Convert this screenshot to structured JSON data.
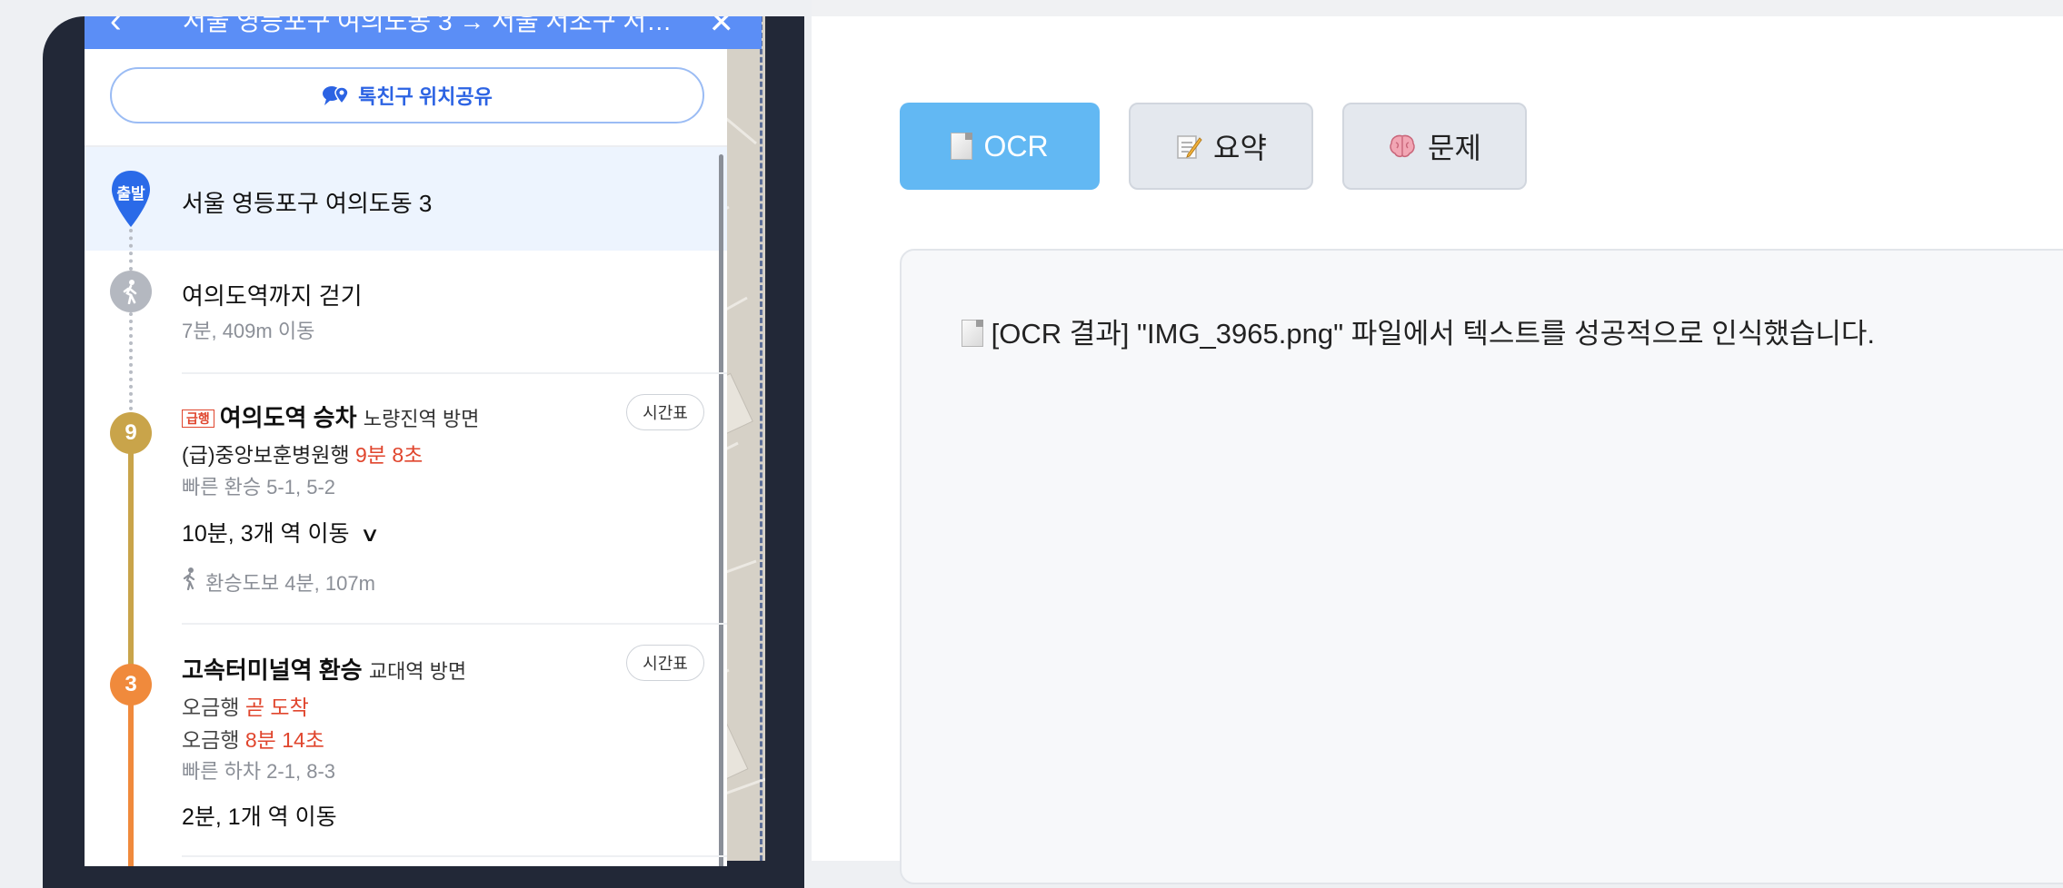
{
  "phone": {
    "nav": {
      "back_icon": "chevron-left-icon",
      "title": "서울 영등포구 여의도동 3 → 서울 서초구 서…",
      "close_icon": "close-icon"
    },
    "share_button": {
      "icon": "location-share-icon",
      "label": "톡친구 위치공유"
    },
    "start": {
      "pin_label": "출발",
      "address": "서울 영등포구 여의도동 3"
    },
    "walk": {
      "title": "여의도역까지 걷기",
      "detail": "7분, 409m 이동"
    },
    "leg1": {
      "line": "9",
      "color": "#c9a44a",
      "express_badge": "급행",
      "station": "여의도역 승차",
      "direction": "노량진역 방면",
      "train_prefix": "(급)중앙보훈병원행",
      "arrival": "9분 8초",
      "fast_transfer": "빠른 환승 5-1, 5-2",
      "ride": "10분, 3개 역 이동",
      "transfer_walk": "환승도보 4분, 107m",
      "timetable": "시간표"
    },
    "leg2": {
      "line": "3",
      "color": "#f08a3c",
      "station": "고속터미널역 환승",
      "direction": "교대역 방면",
      "train1_prefix": "오금행",
      "train1_arrival": "곧 도착",
      "train2_prefix": "오금행",
      "train2_arrival": "8분 14초",
      "fast_exit": "빠른 하차 2-1, 8-3",
      "ride": "2분, 1개 역 이동",
      "timetable": "시간표"
    }
  },
  "tabs": [
    {
      "label": "OCR",
      "icon": "document-icon",
      "active": true
    },
    {
      "label": "요약",
      "icon": "memo-icon",
      "active": false
    },
    {
      "label": "문제",
      "icon": "brain-icon",
      "active": false
    }
  ],
  "result": {
    "text": "[OCR 결과] \"IMG_3965.png\" 파일에서 텍스트를 성공적으로 인식했습니다."
  },
  "colors": {
    "accent": "#62b8f3",
    "nav": "#5b8ef6",
    "line9": "#c9a44a",
    "line3": "#f08a3c",
    "alert": "#e0452d"
  }
}
